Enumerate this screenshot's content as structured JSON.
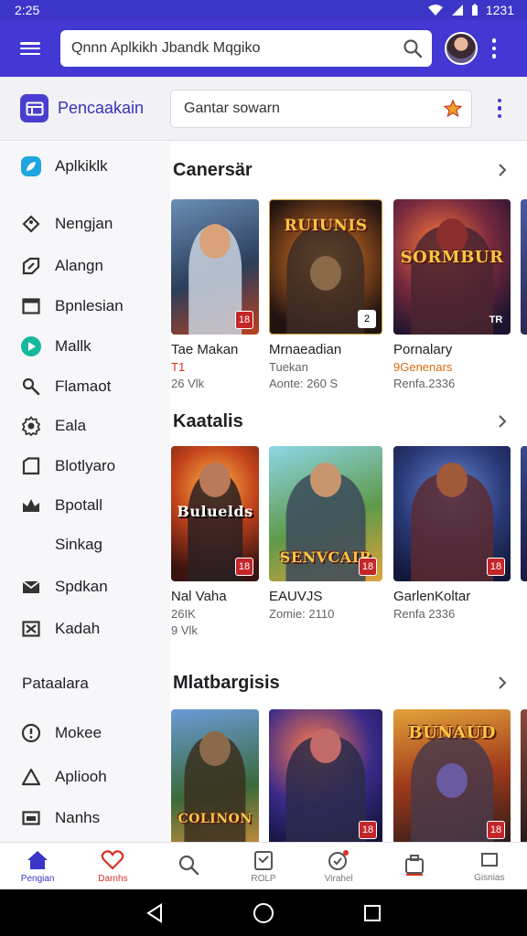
{
  "status_bar": {
    "time": "2:25",
    "clock": "1231"
  },
  "app_bar": {
    "search_value": "Qnnn Aplkikh Jbandk Mqgiko",
    "search_icon": "search-icon",
    "avatar": "user-avatar",
    "menu_icon": "hamburger-icon"
  },
  "sub_bar": {
    "brand_label": "Pencaakain",
    "search_value": "Gantar sowarn",
    "star_icon": "star-icon"
  },
  "sidebar": {
    "header_item": {
      "label": "Aplkiklk",
      "icon": "leaf-icon"
    },
    "items": [
      {
        "label": "Nengjan",
        "icon": "tag-icon"
      },
      {
        "label": "Alangn",
        "icon": "puzzle-icon"
      },
      {
        "label": "Bpnlesian",
        "icon": "window-icon"
      },
      {
        "label": "Mallk",
        "icon": "play-circle-icon"
      },
      {
        "label": "Flamaot",
        "icon": "search-people-icon"
      },
      {
        "label": "Eala",
        "icon": "settings-icon"
      },
      {
        "label": "Blotlyaro",
        "icon": "folder-icon"
      },
      {
        "label": "Bpotall",
        "icon": "crown-icon"
      },
      {
        "label": "Sinkag",
        "icon": ""
      },
      {
        "label": "Spdkan",
        "icon": "mail-icon"
      },
      {
        "label": "Kadah",
        "icon": "cross-box-icon"
      }
    ],
    "section_heading": "Pataalara",
    "bottom_items": [
      {
        "label": "Mokee",
        "icon": "info-icon"
      },
      {
        "label": "Apliooh",
        "icon": "triangle-icon"
      },
      {
        "label": "Nanhs",
        "icon": "card-icon"
      }
    ]
  },
  "sections": [
    {
      "title": "Canersär",
      "cards": [
        {
          "name": "Tae Makan",
          "line2": "T1",
          "line3": "26 Vlk",
          "thumb_text": "",
          "badge": ""
        },
        {
          "name": "Mrnaeadian",
          "line2": "Tuekan",
          "line3": "Aonte: 260 S",
          "thumb_text": "RUIUNIS",
          "badge": "2"
        },
        {
          "name": "Pornalary",
          "line2": "9Genenars",
          "line3": "Renfa.2336",
          "thumb_text": "SORMBUR",
          "badge": "TR"
        }
      ]
    },
    {
      "title": "Kaatalis",
      "cards": [
        {
          "name": "Nal Vaha",
          "line2": "26IK",
          "line3": "9 Vlk",
          "thumb_text": "Buluelds",
          "badge": ""
        },
        {
          "name": "EAUVJS",
          "line2": "Zomie: 2110",
          "line3": "",
          "thumb_text": "SENVCAIR",
          "badge": ""
        },
        {
          "name": "GarlenKoltar",
          "line2": "Renfa 2336",
          "line3": "",
          "thumb_text": "",
          "badge": ""
        }
      ]
    },
    {
      "title": "Mlatbargisis",
      "cards": [
        {
          "name": "",
          "line2": "",
          "line3": "",
          "thumb_text": "COLINON",
          "badge": ""
        },
        {
          "name": "",
          "line2": "",
          "line3": "",
          "thumb_text": "",
          "badge": ""
        },
        {
          "name": "",
          "line2": "",
          "line3": "",
          "thumb_text": "BUNAUD",
          "badge": ""
        }
      ]
    }
  ],
  "bottom_nav": [
    {
      "label": "Pengian",
      "icon": "home-icon",
      "active": true
    },
    {
      "label": "Darnhs",
      "icon": "heart-icon",
      "active": false
    },
    {
      "label": "",
      "icon": "search-icon",
      "active": false
    },
    {
      "label": "ROLP",
      "icon": "calendar-icon",
      "active": false
    },
    {
      "label": "Virahel",
      "icon": "badge-check-icon",
      "active": false
    },
    {
      "label": "",
      "icon": "briefcase-icon",
      "active": false
    },
    {
      "label": "Gisnias",
      "icon": "square-icon",
      "active": false
    }
  ],
  "system_nav": {
    "back": "back-icon",
    "home": "home-circle-icon",
    "recents": "recents-icon"
  },
  "colors": {
    "primary": "#4338d4",
    "accent_red": "#d93025",
    "sidebar_bg": "#f7f7f9"
  }
}
